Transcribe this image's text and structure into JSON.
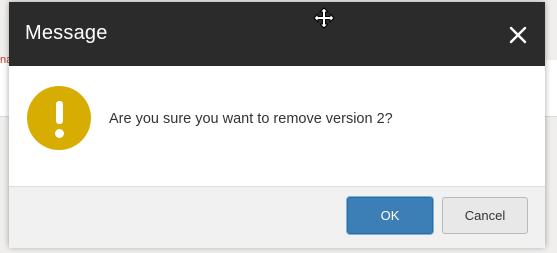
{
  "backdrop": {
    "fragment_text": "na"
  },
  "dialog": {
    "title": "Message",
    "message": "Are you sure you want to remove version 2?",
    "icons": {
      "status": "warning-icon",
      "close": "close-icon",
      "cursor": "move-cursor-icon"
    },
    "buttons": {
      "ok_label": "OK",
      "cancel_label": "Cancel"
    },
    "colors": {
      "header": "#2b2b2b",
      "warning": "#d6ad00",
      "primary": "#3c7fb6"
    }
  }
}
